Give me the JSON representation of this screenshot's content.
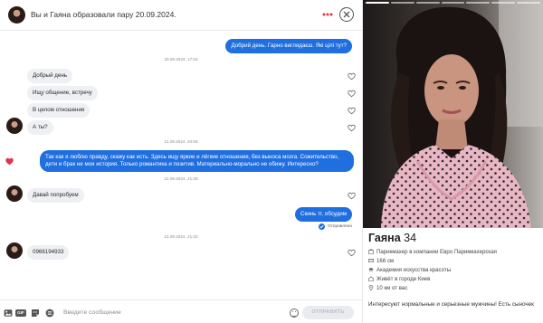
{
  "header": {
    "title": "Вы и Гаяна образовали пару 20.09.2024."
  },
  "messages": {
    "m1": "Добрий день. Гарно виглядаєш. Які цілі тут?",
    "ts1": "20.09.2024, 17:52",
    "m2": "Добрый день",
    "m3": "Ищу общение, встречу",
    "m4": "В целом отношения",
    "m5": "А ты?",
    "ts2": "21.09.2024, 20:58",
    "m6": "Так как я люблю правду, скажу как есть. Здесь ищу яркие и лёгкие отношения, без выноса мозга. Сожительство, дети и брак не моя история. Только романтика и позитив. Материально-морально не обижу. Интересно?",
    "ts3": "21.09.2024, 21:28",
    "m7": "Давай попробуем",
    "m8": "Скинь тг, обсудим",
    "status": "Отправлено",
    "ts4": "21.09.2024, 21:32",
    "m9": "0966194933"
  },
  "input": {
    "placeholder": "Введите сообщение",
    "gif_label": "GIF",
    "send_label": "ОТПРАВИТЬ"
  },
  "profile": {
    "name": "Гаяна",
    "age": "34",
    "job": "Парикмахер в компании Евро Парикмахерская",
    "height": "168 см",
    "education": "Академия искусства красоты",
    "city": "Живёт в городе Киев",
    "distance": "10 км от вас",
    "bio": "Интересуют нормальные и серьезные мужчины! Есть сыночек"
  },
  "colors": {
    "accent_blue": "#1f6fe0",
    "incoming_bubble": "#eef0f4",
    "liked_heart": "#e0344b",
    "menu_dots": "#e0344b"
  },
  "icons": [
    "avatar",
    "menu-dots-icon",
    "close-icon",
    "heart-icon",
    "sent-check-icon",
    "image-icon",
    "gif-icon",
    "sticker-icon",
    "options-icon",
    "emoji-icon",
    "briefcase-icon",
    "ruler-icon",
    "graduation-icon",
    "home-icon",
    "location-icon"
  ]
}
